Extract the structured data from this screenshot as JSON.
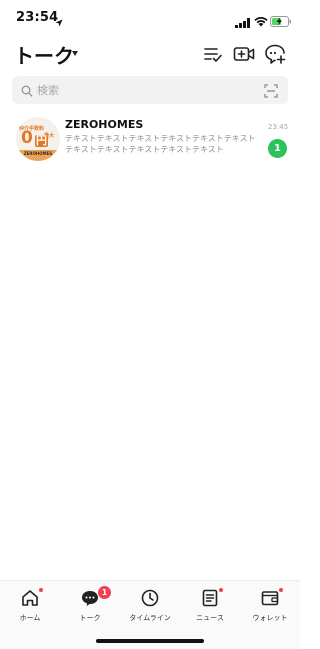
{
  "status_bar": {
    "time": "23:54",
    "location_icon": "location-arrow-icon",
    "signal_icon": "cellular-signal-icon",
    "wifi_icon": "wifi-icon",
    "battery_icon": "battery-charging-icon"
  },
  "header": {
    "title": "トーク",
    "dropdown_icon": "caret-down-icon",
    "icons": [
      "sort-list-icon",
      "video-call-add-icon",
      "new-chat-icon"
    ]
  },
  "search": {
    "placeholder": "検索",
    "value": "",
    "icon": "search-icon",
    "scan_icon": "qr-scan-icon"
  },
  "chats": [
    {
      "name": "ZEROHOMES",
      "preview": "テキストテキストテキストテキストテキストテキストテキストテキストテキストテキストテキスト",
      "time": "23:45",
      "unread": "1",
      "avatar": {
        "top_text": "仲介手数料",
        "max_text": "最大",
        "big_text": "0",
        "yen_text": "円",
        "brand_text": "ZEROHOMES"
      }
    }
  ],
  "tab_bar": {
    "tabs": [
      {
        "label": "ホーム",
        "icon": "home-icon",
        "dot": true
      },
      {
        "label": "トーク",
        "icon": "chat-bubble-icon",
        "badge": "1",
        "active": true
      },
      {
        "label": "タイムライン",
        "icon": "clock-icon"
      },
      {
        "label": "ニュース",
        "icon": "news-icon",
        "dot": true
      },
      {
        "label": "ウォレット",
        "icon": "wallet-icon",
        "dot": true
      }
    ]
  },
  "colors": {
    "accent_green": "#2cc35b",
    "badge_red": "#ef4054",
    "avatar_orange": "#e07a28"
  }
}
